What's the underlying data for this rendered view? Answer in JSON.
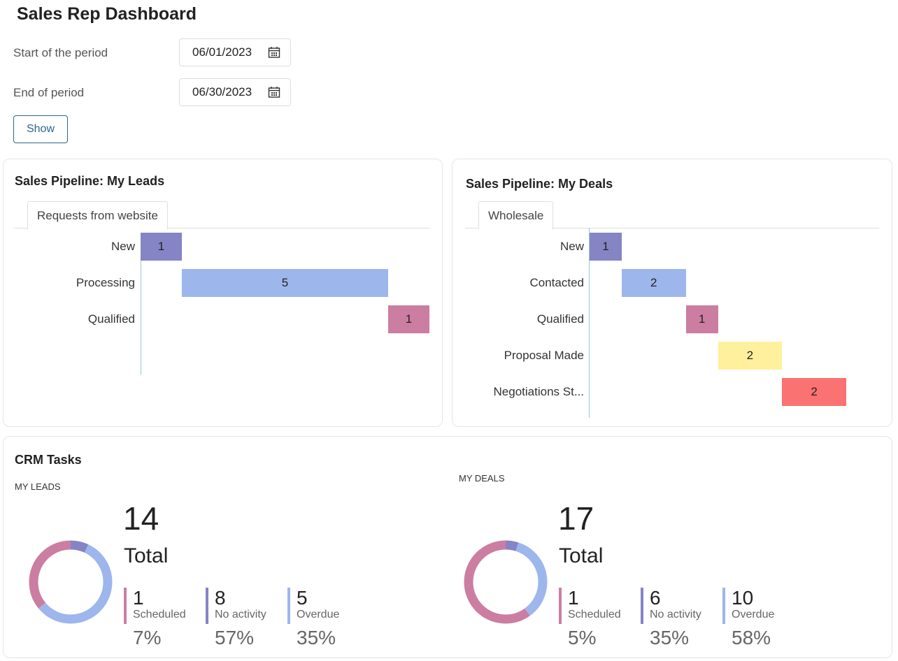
{
  "page_title": "Sales Rep Dashboard",
  "filters": {
    "start_label": "Start of the period",
    "start_value": "06/01/2023",
    "end_label": "End of period",
    "end_value": "06/30/2023",
    "show_label": "Show",
    "calendar_icon": "calendar-icon"
  },
  "leads_pipeline": {
    "title": "Sales Pipeline: My Leads",
    "tab": "Requests from website",
    "stages": [
      {
        "label": "New",
        "value": 1,
        "color": "#8584c5"
      },
      {
        "label": "Processing",
        "value": 5,
        "color": "#9db6ec"
      },
      {
        "label": "Qualified",
        "value": 1,
        "color": "#cb7ea1"
      }
    ]
  },
  "deals_pipeline": {
    "title": "Sales Pipeline: My Deals",
    "tab": "Wholesale",
    "stages": [
      {
        "label": "New",
        "value": 1,
        "color": "#8584c5"
      },
      {
        "label": "Contacted",
        "value": 2,
        "color": "#9db6ec"
      },
      {
        "label": "Qualified",
        "value": 1,
        "color": "#cb7ea1"
      },
      {
        "label": "Proposal Made",
        "value": 2,
        "color": "#fff09e"
      },
      {
        "label": "Negotiations St...",
        "value": 2,
        "color": "#fb7273"
      }
    ]
  },
  "crm_tasks": {
    "title": "CRM Tasks",
    "leads": {
      "label": "MY LEADS",
      "total": "14",
      "total_label": "Total",
      "stats": [
        {
          "count": "1",
          "label": "Scheduled",
          "pct": "7%",
          "color": "#cb7ea1"
        },
        {
          "count": "8",
          "label": "No activity",
          "pct": "57%",
          "color": "#8584c5"
        },
        {
          "count": "5",
          "label": "Overdue",
          "pct": "35%",
          "color": "#9db6ec"
        }
      ],
      "donut": [
        {
          "value": 7,
          "color": "#8584c5"
        },
        {
          "value": 57,
          "color": "#9db6ec"
        },
        {
          "value": 36,
          "color": "#cb7ea1"
        }
      ]
    },
    "deals": {
      "label": "MY DEALS",
      "total": "17",
      "total_label": "Total",
      "stats": [
        {
          "count": "1",
          "label": "Scheduled",
          "pct": "5%",
          "color": "#cb7ea1"
        },
        {
          "count": "6",
          "label": "No activity",
          "pct": "35%",
          "color": "#8584c5"
        },
        {
          "count": "10",
          "label": "Overdue",
          "pct": "58%",
          "color": "#9db6ec"
        }
      ],
      "donut": [
        {
          "value": 5,
          "color": "#8584c5"
        },
        {
          "value": 35,
          "color": "#9db6ec"
        },
        {
          "value": 60,
          "color": "#cb7ea1"
        }
      ]
    }
  }
}
